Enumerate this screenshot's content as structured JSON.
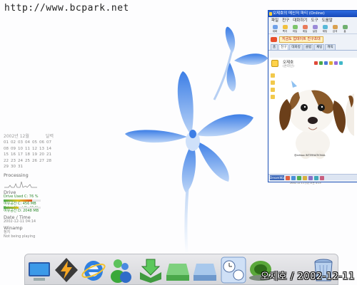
{
  "desktop": {
    "watermark": "http://www.bcpark.net",
    "dock_label": "오제호 / 2002-12-11 04:14:40"
  },
  "calendar": {
    "month_title": "2002년 12월",
    "view_label": "달력",
    "days": [
      "01",
      "02",
      "03",
      "04",
      "05",
      "06",
      "07",
      "08",
      "09",
      "10",
      "11",
      "12",
      "13",
      "14",
      "15",
      "16",
      "17",
      "18",
      "19",
      "20",
      "21",
      "22",
      "23",
      "24",
      "25",
      "26",
      "27",
      "28",
      "29",
      "30",
      "31"
    ]
  },
  "widgets": {
    "processing_title": "Processing",
    "drive_title": "Drive",
    "drive_lines": [
      "Drive Used C: 76 %",
      "여유공간 C: 456 MB",
      "Drive Used D: 41 %",
      "여유공간 D: 2048 MB"
    ],
    "drive_fill": [
      0.76,
      0.41
    ],
    "date_time_title": "Date / Time",
    "date_time_value": "2002-12-11  04:14",
    "winamp_title": "Winamp",
    "winamp_state": "정지",
    "winamp_track": "Not being playing"
  },
  "messenger": {
    "title": "오제호의 메신저 파티 (Online)",
    "menu": [
      "파일",
      "친구",
      "대화하기",
      "도구",
      "도움말"
    ],
    "toolbar": [
      "대화",
      "쪽지",
      "파일",
      "메일",
      "설정",
      "채팅",
      "검색",
      "홈"
    ],
    "promo_text": "지금도 업데이트 친구초대",
    "tabs": [
      "홈",
      "친구",
      "대화방",
      "클럽",
      "채팅",
      "캐릭"
    ],
    "user_name": "오제호",
    "user_status": "(온라인)",
    "image_caption": "@artbox INTERNATIONAL",
    "bottom_logo": "DreamWiz",
    "footer_date": "2002.12.11 (수) 오전 4:13"
  },
  "dock": {
    "icons": [
      "my-computer-icon",
      "winamp-icon",
      "internet-explorer-icon",
      "messenger-icon",
      "download-folder-icon",
      "drive-icon",
      "drive-2-icon",
      "clock-settings-icon",
      "game-icon",
      "trash-icon"
    ]
  }
}
